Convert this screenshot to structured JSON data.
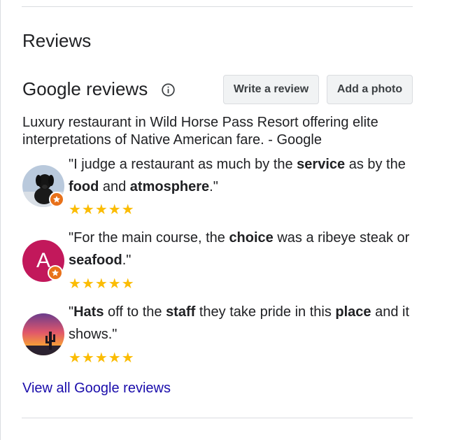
{
  "section": {
    "title": "Reviews"
  },
  "google_reviews": {
    "title": "Google reviews",
    "info_icon": "info-icon",
    "write_review_label": "Write a review",
    "add_photo_label": "Add a photo",
    "description": "Luxury restaurant in Wild Horse Pass Resort offering elite interpretations of Native American fare. - Google"
  },
  "reviews": [
    {
      "avatar": "dog-photo-avatar",
      "segments": [
        {
          "t": "\"I judge a restaurant as much by the ",
          "b": false
        },
        {
          "t": "service",
          "b": true
        },
        {
          "t": " as by the ",
          "b": false
        },
        {
          "t": "food",
          "b": true
        },
        {
          "t": " and ",
          "b": false
        },
        {
          "t": "atmosphere",
          "b": true
        },
        {
          "t": ".\"",
          "b": false
        }
      ],
      "rating": 5,
      "stars_text": "★★★★★"
    },
    {
      "avatar": "letter-avatar",
      "avatar_letter": "A",
      "avatar_color": "#c2185b",
      "segments": [
        {
          "t": "\"For the main course, the ",
          "b": false
        },
        {
          "t": "choice",
          "b": true
        },
        {
          "t": " was a ribeye steak or ",
          "b": false
        },
        {
          "t": "seafood",
          "b": true
        },
        {
          "t": ".\"",
          "b": false
        }
      ],
      "rating": 5,
      "stars_text": "★★★★★"
    },
    {
      "avatar": "desert-sunset-avatar",
      "segments": [
        {
          "t": "\"",
          "b": false
        },
        {
          "t": "Hats",
          "b": true
        },
        {
          "t": " off to the ",
          "b": false
        },
        {
          "t": "staff",
          "b": true
        },
        {
          "t": " they take pride in this ",
          "b": false
        },
        {
          "t": "place",
          "b": true
        },
        {
          "t": " and it shows.\"",
          "b": false
        }
      ],
      "rating": 5,
      "stars_text": "★★★★★"
    }
  ],
  "view_all_label": "View all Google reviews",
  "colors": {
    "star": "#fbbc04",
    "link": "#1a0dab",
    "badge": "#e8711a",
    "button_bg": "#f1f3f4"
  }
}
